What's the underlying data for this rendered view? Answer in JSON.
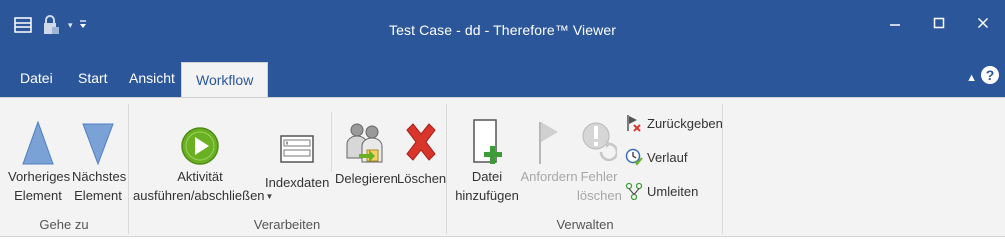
{
  "window": {
    "title": "Test Case - dd - Therefore™ Viewer"
  },
  "qat": {
    "icons": [
      "layout-icon",
      "lock-icon",
      "dropdown-icon",
      "customize-icon"
    ]
  },
  "tabs": [
    {
      "label": "Datei"
    },
    {
      "label": "Start"
    },
    {
      "label": "Ansicht"
    },
    {
      "label": "Workflow",
      "active": true
    }
  ],
  "groups": {
    "gehe_zu": {
      "label": "Gehe zu",
      "prev": {
        "line1": "Vorheriges",
        "line2": "Element"
      },
      "next": {
        "line1": "Nächstes",
        "line2": "Element"
      }
    },
    "verarbeiten": {
      "label": "Verarbeiten",
      "activity": {
        "line1": "Aktivität",
        "line2": "ausführen/abschließen"
      },
      "indexdata": {
        "label": "Indexdaten"
      },
      "delegate": {
        "label": "Delegieren"
      },
      "delete": {
        "label": "Löschen"
      }
    },
    "verwalten": {
      "label": "Verwalten",
      "add_file": {
        "line1": "Datei",
        "line2": "hinzufügen"
      },
      "request": {
        "label": "Anfordern"
      },
      "error_delete": {
        "line1": "Fehler",
        "line2": "löschen"
      },
      "return": {
        "label": "Zurückgeben"
      },
      "history": {
        "label": "Verlauf"
      },
      "redirect": {
        "label": "Umleiten"
      }
    }
  },
  "colors": {
    "titlebar": "#2b579a",
    "ribbon": "#f3f3f3",
    "green": "#6ab023",
    "red": "#d9352b",
    "arrow_blue": "#7aa2d6"
  }
}
